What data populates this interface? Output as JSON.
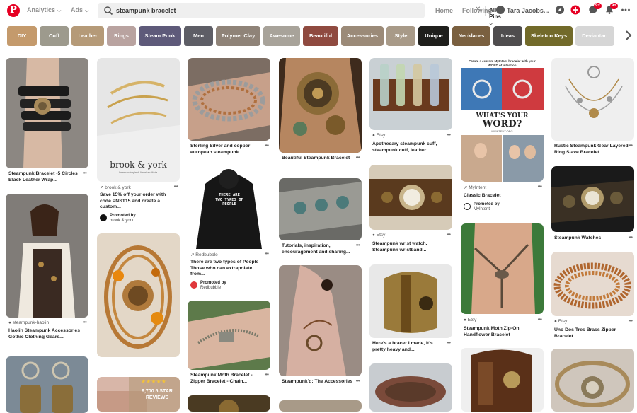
{
  "header": {
    "analytics": "Analytics",
    "ads": "Ads",
    "search_value": "steampunk bracelet",
    "search_scope": "All Pins",
    "home": "Home",
    "following": "Following",
    "user_name": "Tara Jacobs...",
    "messages_badge": "9+",
    "notifications_badge": "9+"
  },
  "chips": [
    {
      "label": "DIY",
      "color": "#c49a6c"
    },
    {
      "label": "Cuff",
      "color": "#9d9a8d"
    },
    {
      "label": "Leather",
      "color": "#b59a78"
    },
    {
      "label": "Rings",
      "color": "#b9a3a0"
    },
    {
      "label": "Steam Punk",
      "color": "#5e5a7a"
    },
    {
      "label": "Men",
      "color": "#5e5e66"
    },
    {
      "label": "Polymer Clay",
      "color": "#8f8378"
    },
    {
      "label": "Awesome",
      "color": "#a8a39a"
    },
    {
      "label": "Beautiful",
      "color": "#8f4a40"
    },
    {
      "label": "Accessories",
      "color": "#9b8a78"
    },
    {
      "label": "Style",
      "color": "#a89a88"
    },
    {
      "label": "Unique",
      "color": "#1f1f1c"
    },
    {
      "label": "Necklaces",
      "color": "#7a6040"
    },
    {
      "label": "Ideas",
      "color": "#4f4d4e"
    },
    {
      "label": "Skeleton Keys",
      "color": "#726a2a"
    },
    {
      "label": "Deviantart",
      "color": "#d6d6d6"
    }
  ],
  "pins": {
    "p1": {
      "title": "Steampunk Bracelet -5 Circles Black Leather Wrap..."
    },
    "p2": {
      "source": "steampunk-haolin",
      "title": "Haolin Steampunk Accessories Gothic Clothing Gears..."
    },
    "p3": {
      "brand": "brook & york",
      "brand_sub": "American Inspired. American Made.",
      "source": "brook & york",
      "title": "Save 15% off your order with code PNST15 and create a custom...",
      "promoted": "Promoted by",
      "promoter": "brook & york"
    },
    "p4": {
      "overlay": "9,700 5 STAR REVIEWS"
    },
    "p5": {
      "title": "Sterling Silver and copper european steampunk..."
    },
    "p6": {
      "shirt_text": "THERE ARE TWO TYPES OF PEOPLE",
      "source": "Redbubble",
      "title": "There are two types of People Those who can extrapolate from...",
      "promoted": "Promoted by",
      "promoter": "Redbubble"
    },
    "p7": {
      "title": "Steampunk Moth Bracelet - Zipper Bracelet - Chain..."
    },
    "p8": {
      "title": "Beautiful Steampunk Bracelet"
    },
    "p9": {
      "title": "Tutorials, inspiration, encouragement and sharing..."
    },
    "p10": {
      "title": "Steampunk'd: The Accessories"
    },
    "p11": {
      "source": "Etsy",
      "title": "Apothecary steampunk cuff, steampunk cuff, leather..."
    },
    "p12": {
      "source": "Etsy",
      "title": "Steampunk wrist watch, Steampunk wristband..."
    },
    "p13": {
      "title": "Here's a bracer I made, It's pretty heavy and..."
    },
    "p14": {
      "ad_top": "Create a custom MyIntent bracelet with your WORD of intention",
      "ad_q": "WHAT'S YOUR",
      "ad_word": "WORD?",
      "ad_url": "MYINTENT.ORG",
      "source": "MyIntent",
      "title": "Classic Bracelet",
      "promoted": "Promoted by",
      "promoter": "MyIntent"
    },
    "p15": {
      "source": "Etsy",
      "title": "Steampunk Moth Zip-On Handflower Bracelet"
    },
    "p16": {
      "title": "Rustic Steampunk Gear Layered Ring Slave Bracelet..."
    },
    "p17": {
      "title": "Steampunk Watches"
    },
    "p18": {
      "source": "Etsy",
      "title": "Uno Dos Tres Brass Zipper Bracelet"
    }
  }
}
